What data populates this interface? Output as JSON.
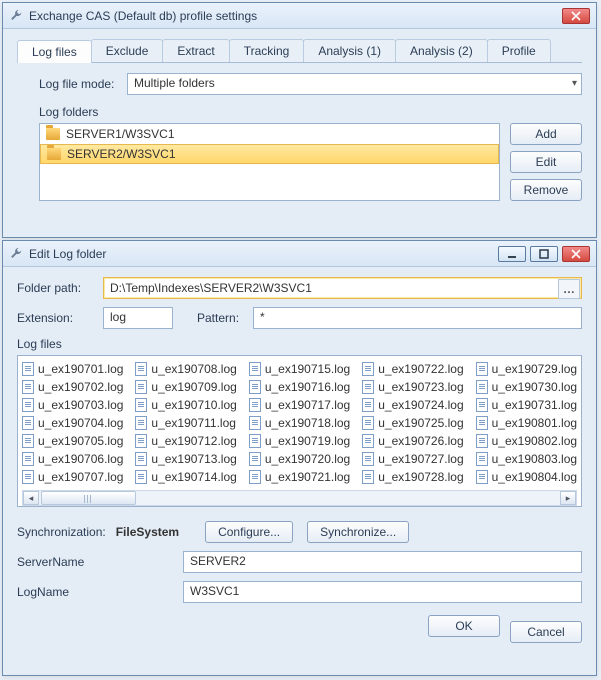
{
  "profile_window": {
    "title": "Exchange CAS (Default db) profile settings",
    "tabs": [
      "Log files",
      "Exclude",
      "Extract",
      "Tracking",
      "Analysis (1)",
      "Analysis (2)",
      "Profile"
    ],
    "active_tab": 0,
    "log_file_mode_label": "Log file mode:",
    "log_file_mode_value": "Multiple folders",
    "log_folders_label": "Log folders",
    "log_folders": [
      "SERVER1/W3SVC1",
      "SERVER2/W3SVC1"
    ],
    "selected_folder": 1,
    "buttons": {
      "add": "Add",
      "edit": "Edit",
      "remove": "Remove"
    }
  },
  "edit_window": {
    "title": "Edit Log folder",
    "folder_path_label": "Folder path:",
    "folder_path_value": "D:\\Temp\\Indexes\\SERVER2\\W3SVC1",
    "extension_label": "Extension:",
    "extension_value": "log",
    "pattern_label": "Pattern:",
    "pattern_value": "*",
    "log_files_label": "Log files",
    "files": {
      "col1": [
        "u_ex190701.log",
        "u_ex190702.log",
        "u_ex190703.log",
        "u_ex190704.log",
        "u_ex190705.log",
        "u_ex190706.log",
        "u_ex190707.log"
      ],
      "col2": [
        "u_ex190708.log",
        "u_ex190709.log",
        "u_ex190710.log",
        "u_ex190711.log",
        "u_ex190712.log",
        "u_ex190713.log",
        "u_ex190714.log"
      ],
      "col3": [
        "u_ex190715.log",
        "u_ex190716.log",
        "u_ex190717.log",
        "u_ex190718.log",
        "u_ex190719.log",
        "u_ex190720.log",
        "u_ex190721.log"
      ],
      "col4": [
        "u_ex190722.log",
        "u_ex190723.log",
        "u_ex190724.log",
        "u_ex190725.log",
        "u_ex190726.log",
        "u_ex190727.log",
        "u_ex190728.log"
      ],
      "col5": [
        "u_ex190729.log",
        "u_ex190730.log",
        "u_ex190731.log",
        "u_ex190801.log",
        "u_ex190802.log",
        "u_ex190803.log",
        "u_ex190804.log"
      ]
    },
    "sync_label": "Synchronization:",
    "sync_value": "FileSystem",
    "configure_btn": "Configure...",
    "synchronize_btn": "Synchronize...",
    "server_name_label": "ServerName",
    "server_name_value": "SERVER2",
    "log_name_label": "LogName",
    "log_name_value": "W3SVC1",
    "ok_btn": "OK",
    "cancel_btn": "Cancel"
  }
}
